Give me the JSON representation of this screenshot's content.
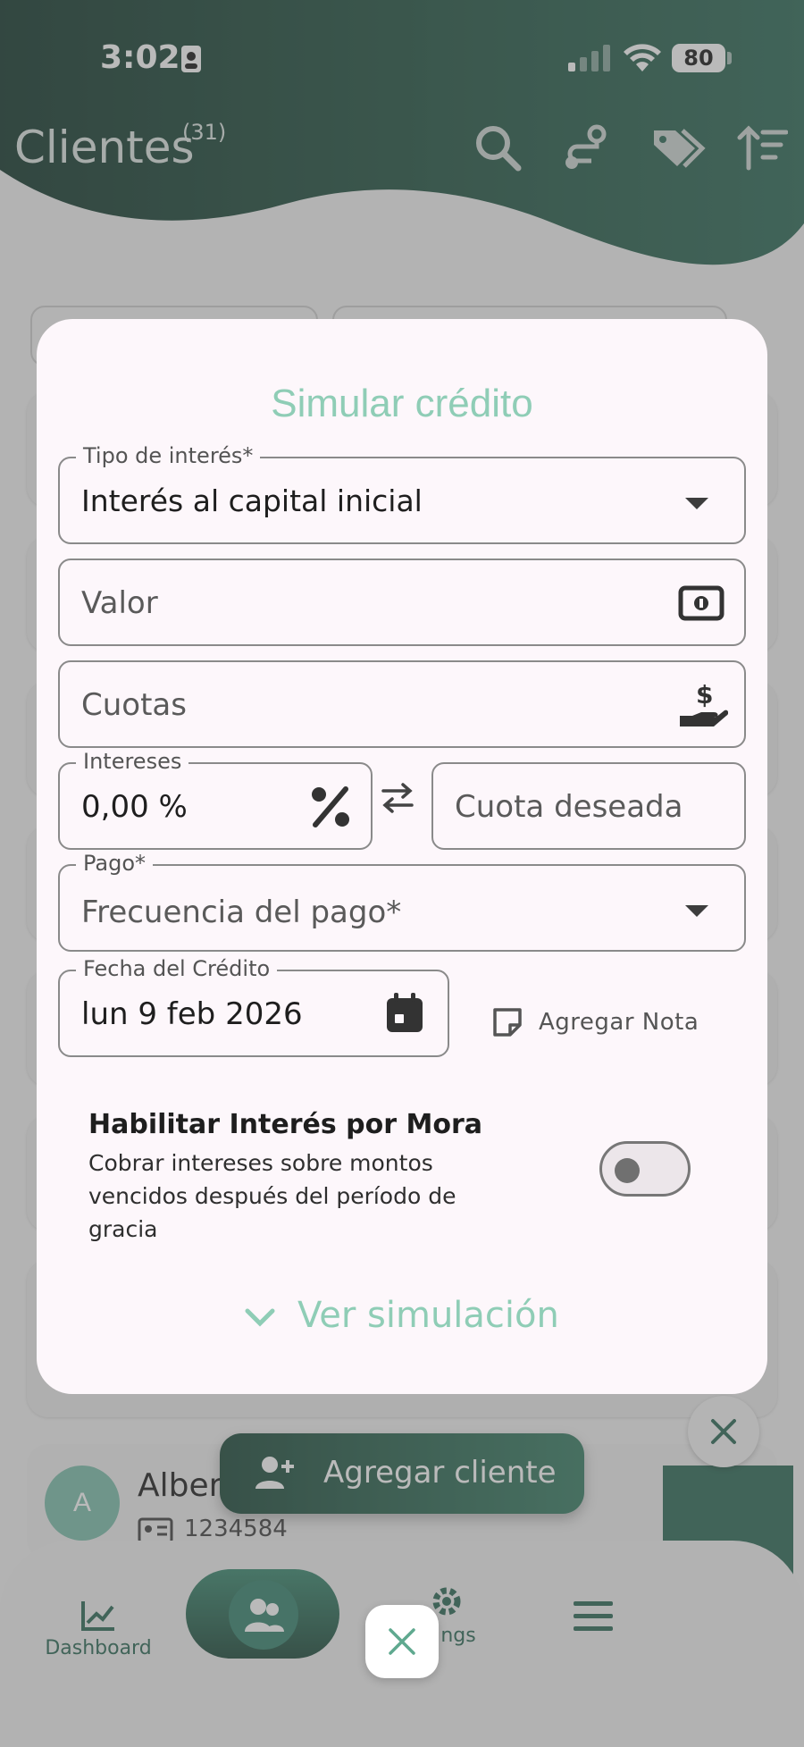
{
  "status_bar": {
    "time": "3:02",
    "battery": "80"
  },
  "header": {
    "title": "Clientes",
    "count": "(31)"
  },
  "client": {
    "avatar_initial": "A",
    "name": "Alber",
    "document": "1234584"
  },
  "fab": {
    "add_client_label": "Agregar cliente"
  },
  "bottom_nav": {
    "dashboard_label": "Dashboard",
    "settings_label": "ngs"
  },
  "modal": {
    "title": "Simular crédito",
    "interest_type": {
      "label": "Tipo de interés*",
      "value": "Interés al capital inicial"
    },
    "valor": {
      "placeholder": "Valor"
    },
    "cuotas": {
      "placeholder": "Cuotas"
    },
    "intereses": {
      "label": "Intereses",
      "value": "0,00 %"
    },
    "cuota_deseada": {
      "placeholder": "Cuota deseada"
    },
    "pago": {
      "label": "Pago*",
      "placeholder": "Frecuencia del pago*"
    },
    "fecha": {
      "label": "Fecha del Crédito",
      "value": "lun 9 feb 2026"
    },
    "add_note_label": "Agregar Nota",
    "mora": {
      "title": "Habilitar Interés por Mora",
      "description": "Cobrar intereses sobre montos vencidos después del período de gracia",
      "enabled": false
    },
    "simulate_link": "Ver simulación"
  },
  "colors": {
    "accent": "#8fcdb6",
    "brand_dark": "#1f4b3c",
    "brand": "#2f6b58"
  }
}
